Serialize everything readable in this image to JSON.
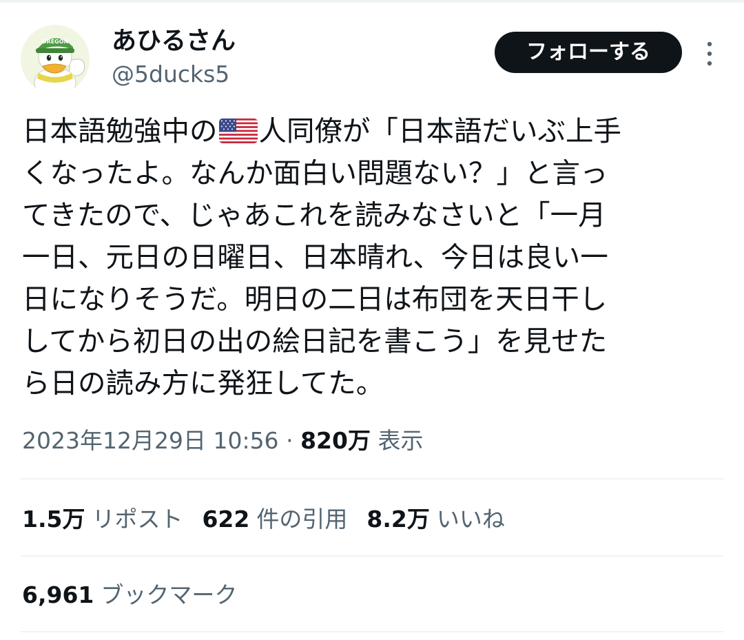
{
  "author": {
    "display_name": "あひるさん",
    "handle": "@5ducks5",
    "avatar_icon": "duck-mascot-avatar-icon",
    "avatar_cap_text": "OREGON"
  },
  "actions": {
    "follow_label": "フォローする",
    "more_icon": "more-vertical-icon"
  },
  "tweet": {
    "lines": [
      {
        "before": "日本語勉強中の",
        "flag": "us-flag-icon",
        "after": "人同僚が「日本語だいぶ上手"
      },
      {
        "text": "くなったよ。なんか面白い問題ない？」と言っ"
      },
      {
        "text": "てきたので、じゃあこれを読みなさいと「一月"
      },
      {
        "text": "一日、元日の日曜日、日本晴れ、今日は良い一"
      },
      {
        "text": "日になりそうだ。明日の二日は布団を天日干し"
      },
      {
        "text": "してから初日の出の絵日記を書こう」を見せた"
      },
      {
        "text": "ら日の読み方に発狂してた。"
      }
    ]
  },
  "meta": {
    "timestamp": "2023年12月29日 10:56",
    "separator": "·",
    "views_count": "820万",
    "views_label": "表示"
  },
  "stats": {
    "reposts_count": "1.5万",
    "reposts_label": "リポスト",
    "quotes_count": "622",
    "quotes_label": "件の引用",
    "likes_count": "8.2万",
    "likes_label": "いいね",
    "bookmarks_count": "6,961",
    "bookmarks_label": "ブックマーク"
  },
  "colors": {
    "text_primary": "#0f1419",
    "text_secondary": "#536471",
    "divider": "#eff3f4",
    "follow_button_bg": "#0f1419",
    "follow_button_text": "#ffffff"
  }
}
